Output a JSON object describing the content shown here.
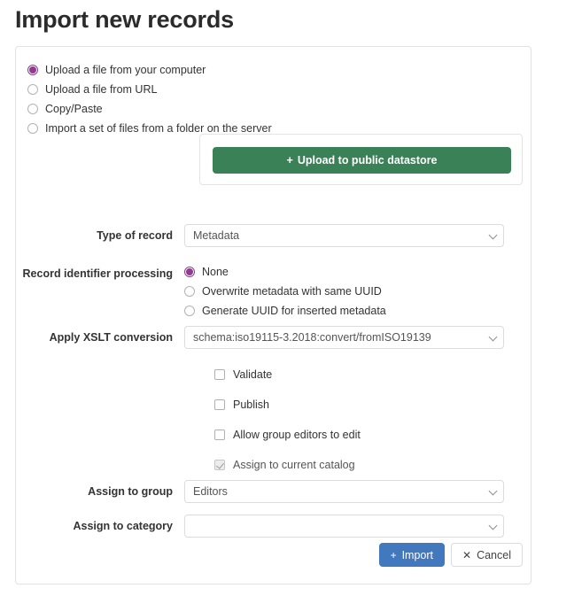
{
  "page": {
    "title": "Import new records"
  },
  "source_options": {
    "items": [
      {
        "label": "Upload a file from your computer",
        "selected": true
      },
      {
        "label": "Upload a file from URL",
        "selected": false
      },
      {
        "label": "Copy/Paste",
        "selected": false
      },
      {
        "label": "Import a set of files from a folder on the server",
        "selected": false
      }
    ]
  },
  "upload": {
    "button_icon": "+",
    "button_label": "Upload to public datastore"
  },
  "type_of_record": {
    "label": "Type of record",
    "value": "Metadata"
  },
  "record_identifier_processing": {
    "label": "Record identifier processing",
    "options": [
      {
        "label": "None",
        "selected": true
      },
      {
        "label": "Overwrite metadata with same UUID",
        "selected": false
      },
      {
        "label": "Generate UUID for inserted metadata",
        "selected": false
      }
    ]
  },
  "xslt_conversion": {
    "label": "Apply XSLT conversion",
    "value": "schema:iso19115-3.2018:convert/fromISO19139"
  },
  "checkboxes": [
    {
      "label": "Validate",
      "checked": false,
      "disabled": false
    },
    {
      "label": "Publish",
      "checked": false,
      "disabled": false
    },
    {
      "label": "Allow group editors to edit",
      "checked": false,
      "disabled": false
    },
    {
      "label": "Assign to current catalog",
      "checked": true,
      "disabled": true
    }
  ],
  "assign_to_group": {
    "label": "Assign to group",
    "value": "Editors"
  },
  "assign_to_category": {
    "label": "Assign to category",
    "value": ""
  },
  "footer": {
    "import_icon": "+",
    "import_label": "Import",
    "cancel_icon": "✕",
    "cancel_label": "Cancel"
  },
  "colors": {
    "radio_accent": "#8e3d8e",
    "upload_green": "#3a8157",
    "import_blue": "#4178be",
    "panel_border": "#e2e2e2"
  }
}
